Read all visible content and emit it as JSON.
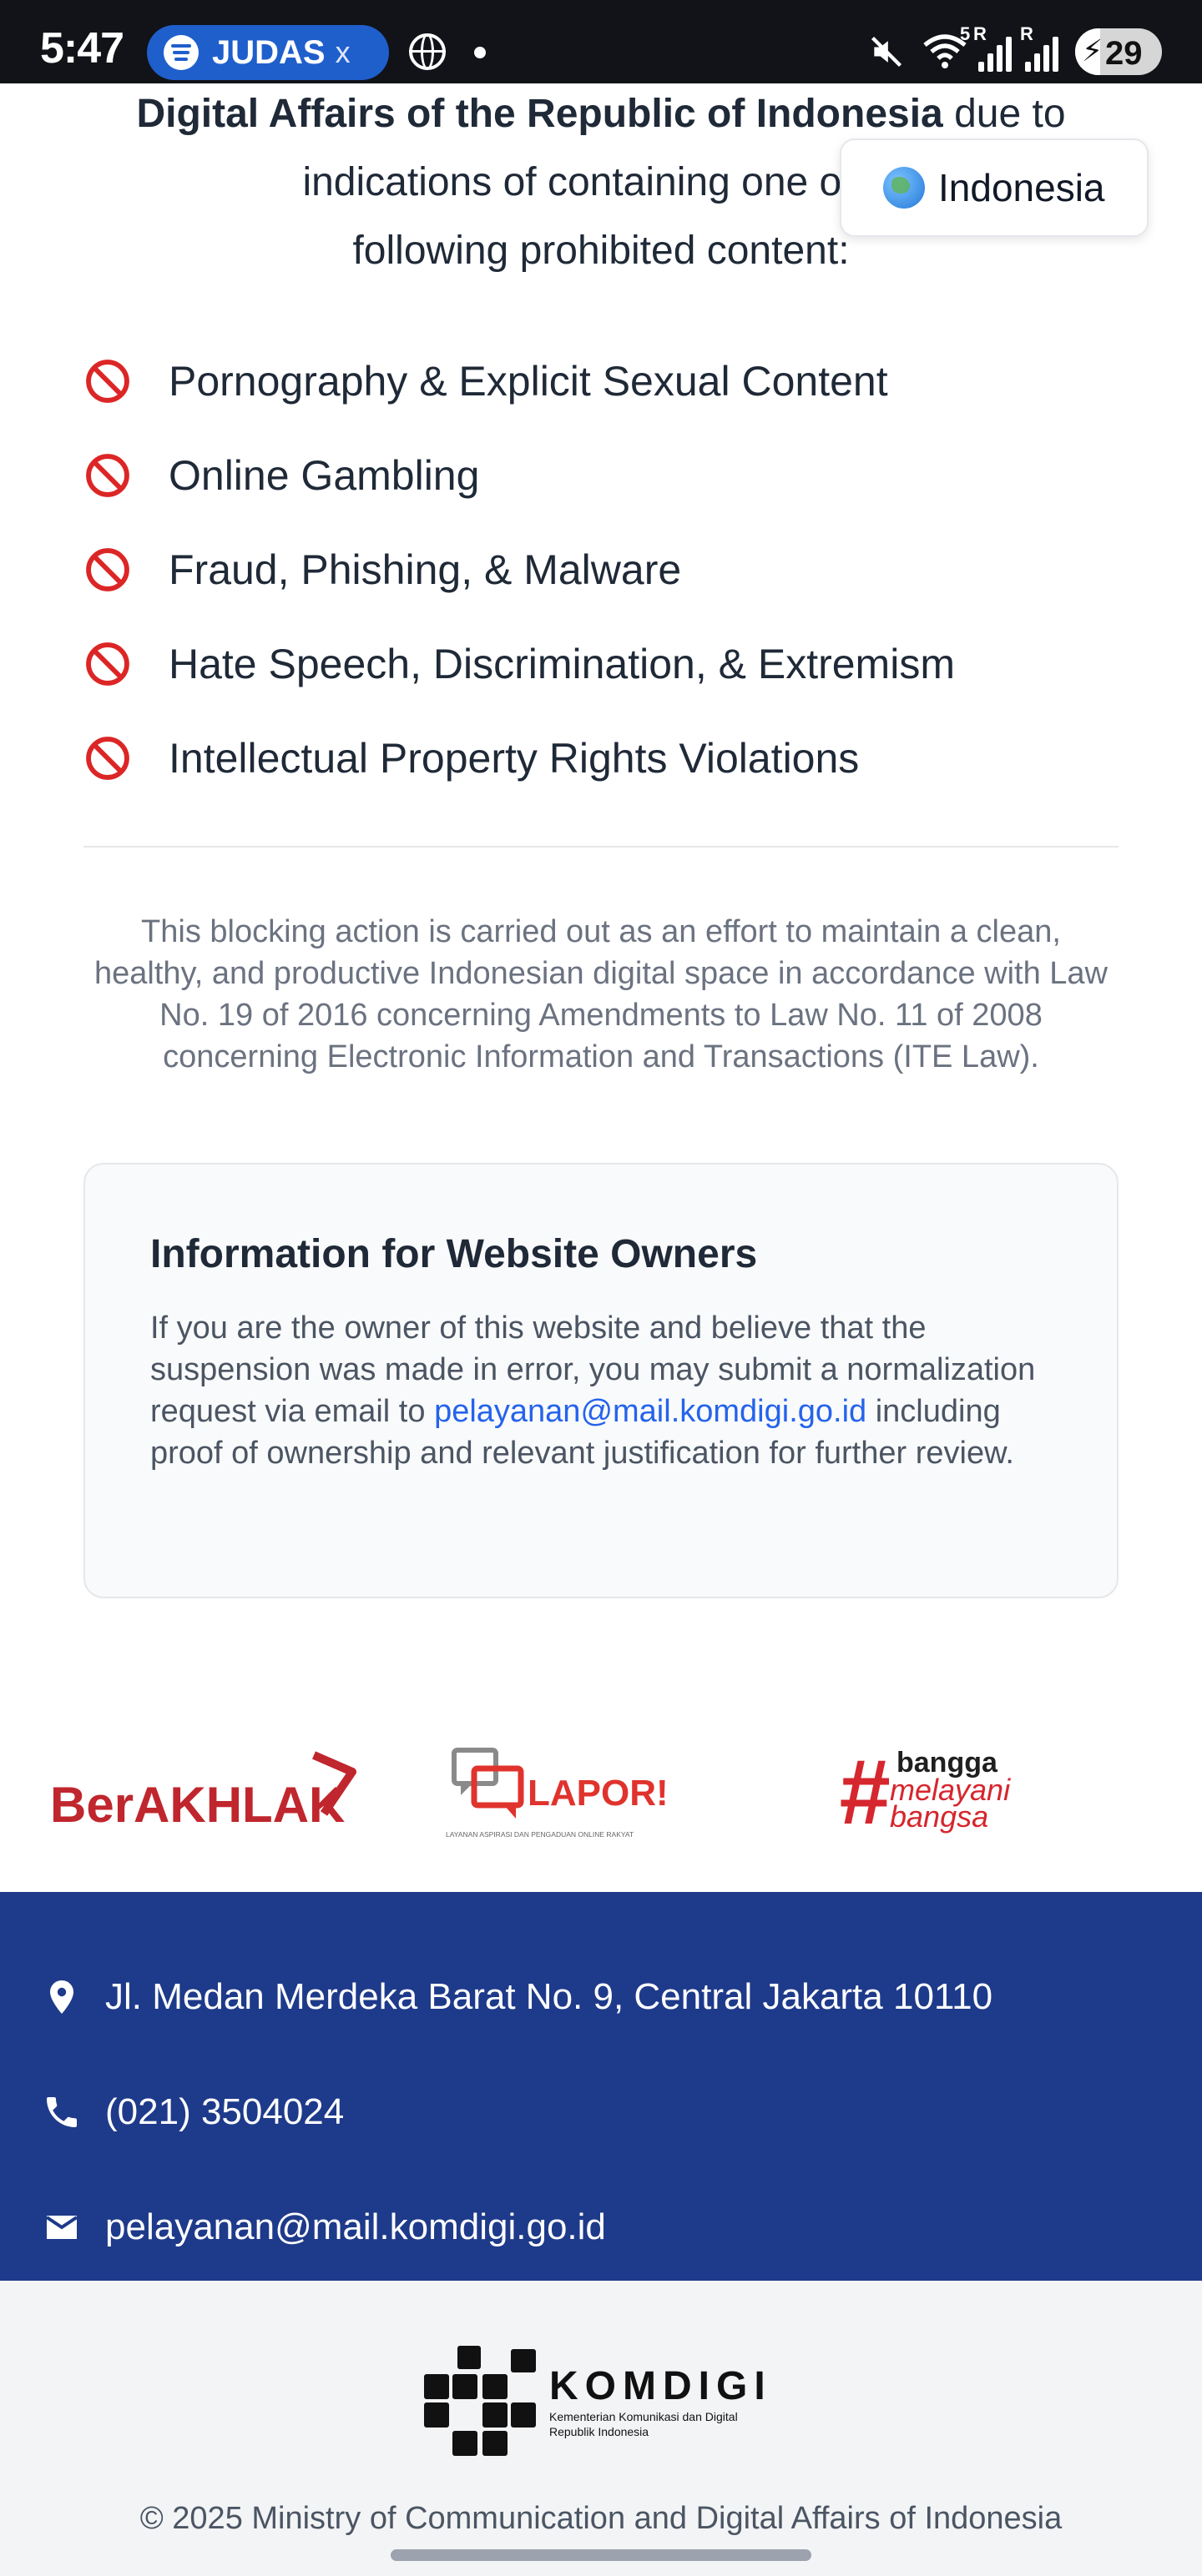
{
  "status_bar": {
    "time": "5:47",
    "media_label": "JUDAS",
    "media_close": "x",
    "network_r1": "R",
    "network_r2": "R",
    "network_5": "5",
    "battery": "29",
    "battery_level": 0.29
  },
  "language_button": {
    "label": "Indonesia"
  },
  "intro": {
    "bold_text": "Digital Affairs of the Republic of Indonesia",
    "line1_rest": " due to",
    "line2": "indications of containing one or m",
    "line3": "following prohibited content:"
  },
  "prohibited_items": [
    "Pornography & Explicit Sexual Content",
    "Online Gambling",
    "Fraud, Phishing, & Malware",
    "Hate Speech, Discrimination, & Extremism",
    "Intellectual Property Rights Violations"
  ],
  "legal_text": "This blocking action is carried out as an effort to maintain a clean, healthy, and productive Indonesian digital space in accordance with Law No. 19 of 2016 concerning Amendments to Law No. 11 of 2008 concerning Electronic Information and Transactions (ITE Law).",
  "owner_info": {
    "title": "Information for Website Owners",
    "text_before": "If you are the owner of this website and believe that the suspension was made in error, you may submit a normalization request via email to ",
    "email": "pelayanan@mail.komdigi.go.id",
    "text_after": " including proof of ownership and relevant justification for further review."
  },
  "logos": {
    "berakhlak": "BerAKHLAK",
    "lapor": "LAPOR!",
    "lapor_sub": "LAYANAN ASPIRASI DAN PENGADUAN ONLINE RAKYAT",
    "bangga_1": "bangga",
    "bangga_2": "melayani",
    "bangga_3": "bangsa"
  },
  "contact": {
    "address": "Jl. Medan Merdeka Barat No. 9, Central Jakarta 10110",
    "phone": "(021) 3504024",
    "email": "pelayanan@mail.komdigi.go.id"
  },
  "footer": {
    "brand": "KOMDIGI",
    "brand_sub_1": "Kementerian Komunikasi dan Digital",
    "brand_sub_2": "Republik Indonesia",
    "copyright": "© 2025 Ministry of Communication and Digital Affairs of Indonesia"
  },
  "colors": {
    "status_bar_bg": "#111318",
    "media_pill": "#1f5fcc",
    "ban_red": "#dc2626",
    "link_blue": "#2563eb",
    "contact_bg": "#1e3a8a",
    "footer_bg": "#f3f4f6",
    "berakhlak_red": "#c0262d"
  }
}
